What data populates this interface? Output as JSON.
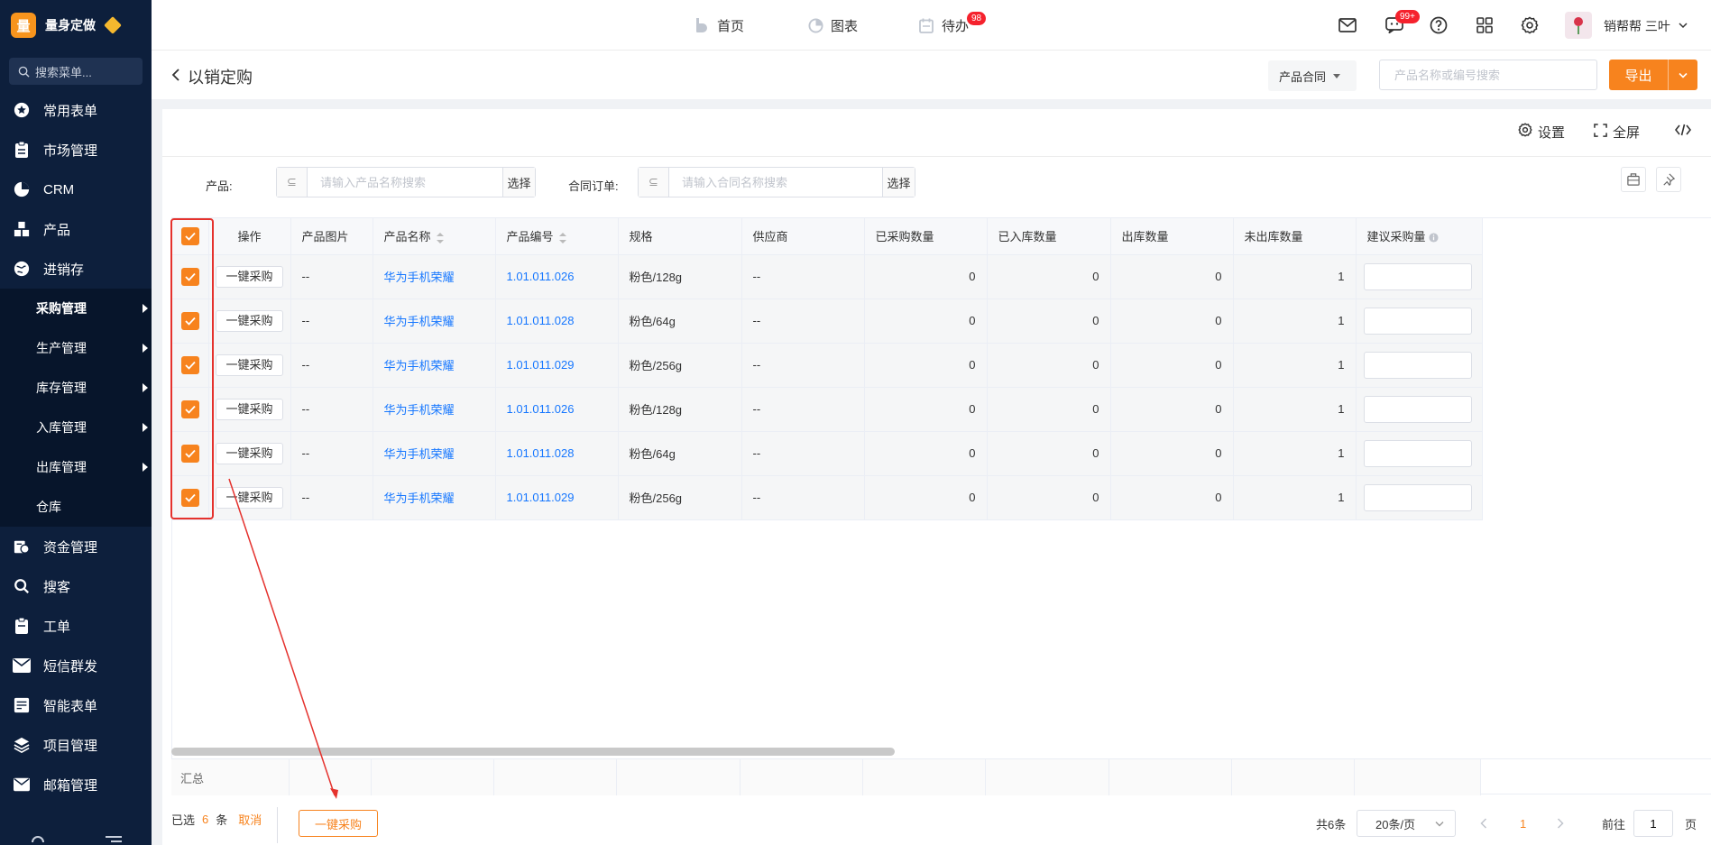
{
  "brand": {
    "logo_char": "量",
    "name": "量身定做"
  },
  "sidebar": {
    "search_placeholder": "搜索菜单...",
    "menu_top": [
      {
        "label": "常用表单",
        "icon": "star-icon"
      },
      {
        "label": "市场管理",
        "icon": "clipboard-icon"
      },
      {
        "label": "CRM",
        "icon": "pie-icon"
      },
      {
        "label": "产品",
        "icon": "blocks-icon"
      },
      {
        "label": "进销存",
        "icon": "globe-icon"
      }
    ],
    "submenu": [
      {
        "label": "采购管理",
        "active": true,
        "arrow": true
      },
      {
        "label": "生产管理",
        "active": false,
        "arrow": true
      },
      {
        "label": "库存管理",
        "active": false,
        "arrow": true
      },
      {
        "label": "入库管理",
        "active": false,
        "arrow": true
      },
      {
        "label": "出库管理",
        "active": false,
        "arrow": true
      },
      {
        "label": "仓库",
        "active": false,
        "arrow": false
      }
    ],
    "menu_bottom": [
      {
        "label": "资金管理",
        "icon": "money-icon"
      },
      {
        "label": "搜客",
        "icon": "search-icon"
      },
      {
        "label": "工单",
        "icon": "ticket-icon"
      },
      {
        "label": "短信群发",
        "icon": "sms-icon"
      },
      {
        "label": "智能表单",
        "icon": "form-icon"
      },
      {
        "label": "项目管理",
        "icon": "layers-icon"
      },
      {
        "label": "邮箱管理",
        "icon": "mail-icon"
      }
    ]
  },
  "topbar": {
    "nav": [
      {
        "label": "首页",
        "icon": "home-icon"
      },
      {
        "label": "图表",
        "icon": "chart-icon"
      },
      {
        "label": "待办",
        "icon": "calendar-icon",
        "badge": "98"
      }
    ],
    "message_badge": "99+",
    "user_name": "销帮帮 三叶"
  },
  "page": {
    "title": "以销定购",
    "filter_select": "产品合同",
    "search_placeholder": "产品名称或编号搜索",
    "export_label": "导出"
  },
  "toolbar": {
    "settings": "设置",
    "fullscreen": "全屏"
  },
  "filters": {
    "product_label": "产品:",
    "product_placeholder": "请输入产品名称搜索",
    "product_btn": "选择",
    "contract_label": "合同订单:",
    "contract_placeholder": "请输入合同名称搜索",
    "contract_btn": "选择"
  },
  "table": {
    "columns": [
      "操作",
      "产品图片",
      "产品名称",
      "产品编号",
      "规格",
      "供应商",
      "已采购数量",
      "已入库数量",
      "出库数量",
      "未出库数量",
      "建议采购量"
    ],
    "action_label": "一键采购",
    "rows": [
      {
        "image": "--",
        "name": "华为手机荣耀",
        "code": "1.01.011.026",
        "spec": "粉色/128g",
        "supplier": "--",
        "purchased": "0",
        "stocked": "0",
        "outbound": "0",
        "pending": "1"
      },
      {
        "image": "--",
        "name": "华为手机荣耀",
        "code": "1.01.011.028",
        "spec": "粉色/64g",
        "supplier": "--",
        "purchased": "0",
        "stocked": "0",
        "outbound": "0",
        "pending": "1"
      },
      {
        "image": "--",
        "name": "华为手机荣耀",
        "code": "1.01.011.029",
        "spec": "粉色/256g",
        "supplier": "--",
        "purchased": "0",
        "stocked": "0",
        "outbound": "0",
        "pending": "1"
      },
      {
        "image": "--",
        "name": "华为手机荣耀",
        "code": "1.01.011.026",
        "spec": "粉色/128g",
        "supplier": "--",
        "purchased": "0",
        "stocked": "0",
        "outbound": "0",
        "pending": "1"
      },
      {
        "image": "--",
        "name": "华为手机荣耀",
        "code": "1.01.011.028",
        "spec": "粉色/64g",
        "supplier": "--",
        "purchased": "0",
        "stocked": "0",
        "outbound": "0",
        "pending": "1"
      },
      {
        "image": "--",
        "name": "华为手机荣耀",
        "code": "1.01.011.029",
        "spec": "粉色/256g",
        "supplier": "--",
        "purchased": "0",
        "stocked": "0",
        "outbound": "0",
        "pending": "1"
      }
    ],
    "summary_label": "汇总"
  },
  "footer": {
    "selected_prefix": "已选",
    "selected_count": "6",
    "selected_suffix": "条",
    "cancel": "取消",
    "bulk_button": "一键采购",
    "total": "共6条",
    "page_size": "20条/页",
    "current_page": "1",
    "goto_label": "前往",
    "goto_value": "1",
    "page_suffix": "页"
  },
  "colors": {
    "accent": "#f7831e",
    "sidebar": "#0d1f3c",
    "link": "#1677ff",
    "annotation": "#e5322d"
  }
}
